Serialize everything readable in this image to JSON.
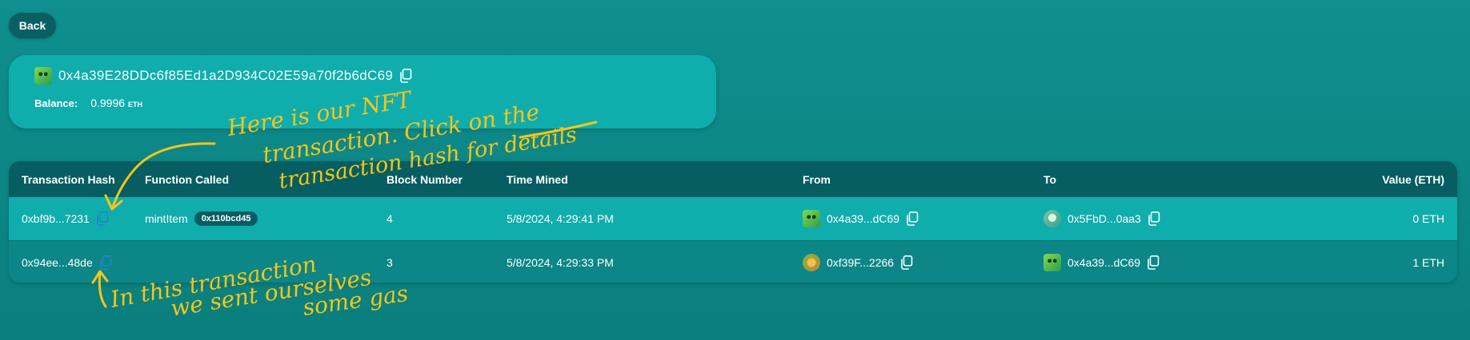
{
  "header": {
    "back_label": "Back"
  },
  "account": {
    "address": "0x4a39E28DDc6f85Ed1a2D934C02E59a70f2b6dC69",
    "balance_label": "Balance:",
    "balance_value": "0.9996",
    "balance_unit": "ETH",
    "avatar_icon": "pixel-avatar-icon",
    "copy_icon": "copy-icon"
  },
  "table": {
    "headers": [
      "Transaction Hash",
      "Function Called",
      "Block Number",
      "Time Mined",
      "From",
      "To",
      "Value (ETH)"
    ],
    "rows": [
      {
        "hash": "0xbf9b...7231",
        "function": "mintItem",
        "function_sig": "0x110bcd45",
        "block": "4",
        "time": "5/8/2024, 4:29:41 PM",
        "from": "0x4a39...dC69",
        "to": "0x5FbD...0aa3",
        "value": "0 ETH"
      },
      {
        "hash": "0x94ee...48de",
        "function": "",
        "function_sig": "",
        "block": "3",
        "time": "5/8/2024, 4:29:33 PM",
        "from": "0xf39F...2266",
        "to": "0x4a39...dC69",
        "value": "1 ETH"
      }
    ]
  },
  "annotations": {
    "nft_note": [
      "Here is our NFT",
      "transaction. Click on the",
      "transaction hash for details"
    ],
    "gas_note": [
      "In this transaction",
      "we sent ourselves",
      "some gas"
    ],
    "color": "#f5c518"
  },
  "colors": {
    "background": "#0f8f8f",
    "card": "#10adad",
    "table_header": "#075e62",
    "row_highlight": "#10adad"
  }
}
